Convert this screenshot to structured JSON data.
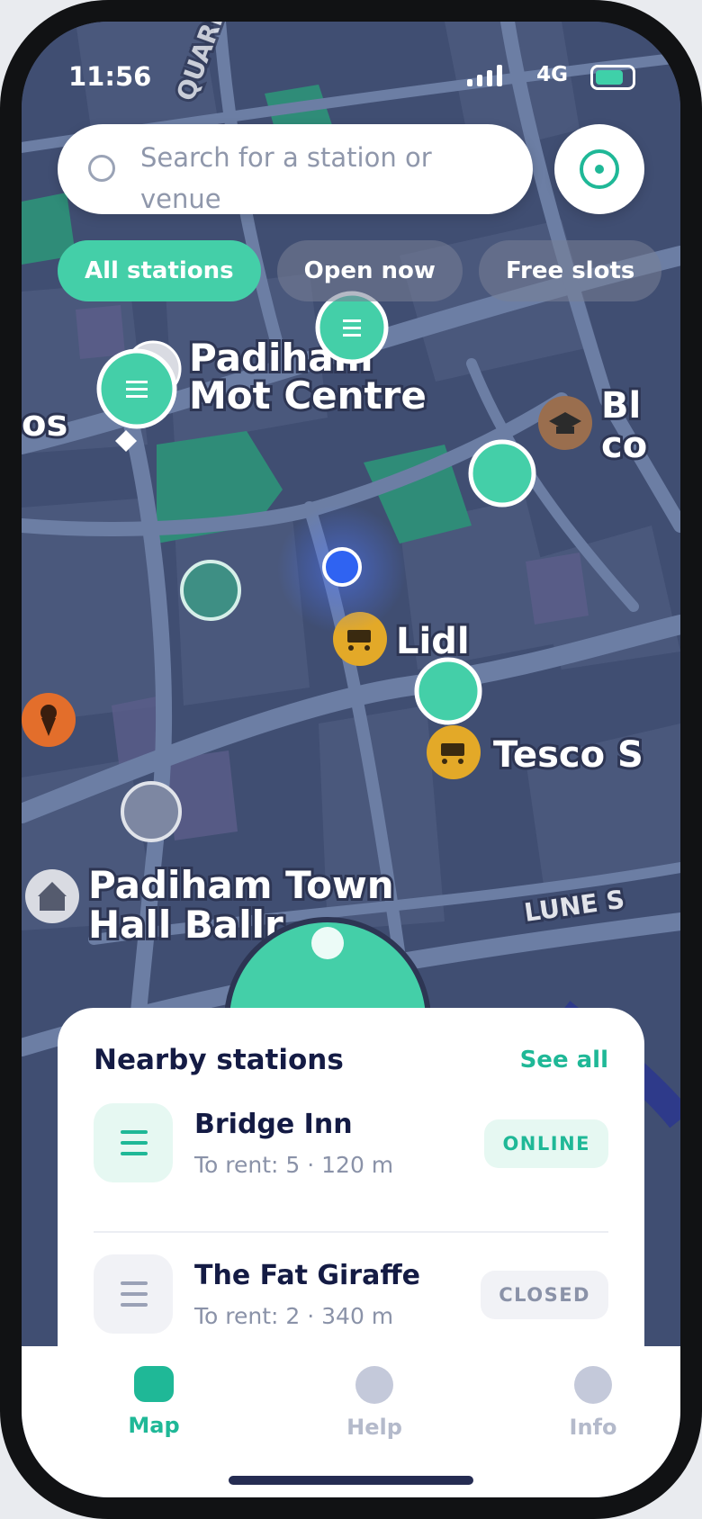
{
  "status_bar": {
    "time": "11:56",
    "network": "4G"
  },
  "search": {
    "placeholder": "Search for a station or venue"
  },
  "filters": [
    "All stations",
    "Open now",
    "Free slots"
  ],
  "active_filter": "All stations",
  "map": {
    "labels": {
      "mot_line1": "Padiham",
      "mot_line2": "Mot Centre",
      "lidl": "Lidl",
      "tesco": "Tesco S",
      "town_hall_line1": "Padiham Town",
      "town_hall_line2": "Hall Ballr",
      "lune": "LUNE S",
      "quarry": "QUARR",
      "edge_left": "os",
      "edge_right1": "Bl",
      "edge_right2": "co"
    }
  },
  "nearby": {
    "title": "Nearby stations",
    "see_all": "See all",
    "stations": [
      {
        "name": "Bridge Inn",
        "meta": "To rent: 5 · 120 m",
        "status": "ONLINE",
        "status_color": "#1fb897"
      },
      {
        "name": "The Fat Giraffe",
        "meta": "To rent: 2 · 340 m",
        "status": "CLOSED",
        "status_color": "#8a92a8"
      }
    ]
  },
  "tabs": [
    {
      "label": "Map",
      "active": true
    },
    {
      "label": "Help",
      "active": false
    },
    {
      "label": "Info",
      "active": false
    }
  ],
  "colors": {
    "accent": "#44cfa8",
    "accent_dark": "#1fb897",
    "user_location": "#2f63f2",
    "map_bg": "#3f4d70"
  }
}
